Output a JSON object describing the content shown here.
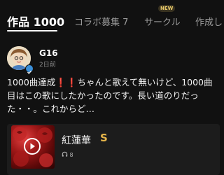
{
  "tabs": {
    "works": "作品 1000",
    "collab": "コラボ募集 7",
    "circle": "サークル",
    "circle_badge": "NEW",
    "create": "作成し"
  },
  "post": {
    "username": "G16",
    "timestamp": "2日前",
    "text": "1000曲達成❗❗ちゃんと歌えて無いけど、1000曲目はこの歌にしたかったのです。長い道のりだった・・。これからど…"
  },
  "media": {
    "title": "紅蓮華",
    "badge": "S",
    "listens": "8"
  },
  "colors": {
    "background": "#111111",
    "accent_gold": "#e6b54a",
    "verified_blue": "#3a8fd9"
  }
}
